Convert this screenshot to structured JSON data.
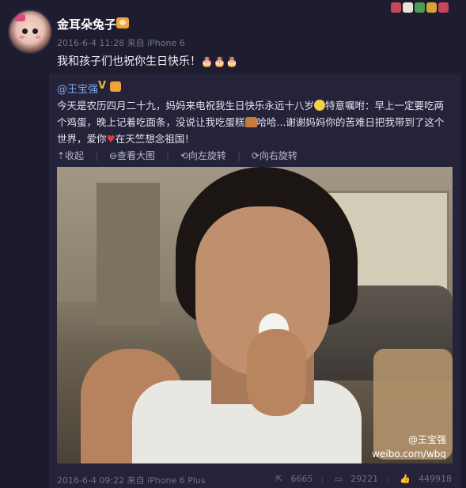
{
  "repost": {
    "author": "金耳朵兔子",
    "meta": "2016-6-4 11:28 来自 iPhone 6",
    "text": "我和孩子们也祝你生日快乐！",
    "emoji": "🎂🎂🎂"
  },
  "original": {
    "author": "@王宝强",
    "text_1": "今天是农历四月二十九，妈妈来电祝我生日快乐永远十八岁",
    "text_2": "特意嘱咐：早上一定要吃两个鸡蛋，晚上记着吃面条，没说让我吃蛋糕",
    "text_3": "哈哈...谢谢妈妈你的苦难日把我带到了这个世界，爱你",
    "text_4": "在天竺想念祖国！",
    "actions": {
      "collapse": "⇡收起",
      "view_large": "⊖查看大图",
      "rotate_left": "⟲向左旋转",
      "rotate_right": "⟳向右旋转"
    },
    "watermark_user": "@王宝强",
    "watermark_url": "weibo.com/wbq",
    "meta": "2016-6-4 09:22 来自 iPhone 6 Plus",
    "reposts": "6665",
    "comments": "29221",
    "likes": "449918"
  },
  "colors": {
    "background": "#1c1a2c",
    "link": "#7fa8e8",
    "meta": "#747391"
  }
}
